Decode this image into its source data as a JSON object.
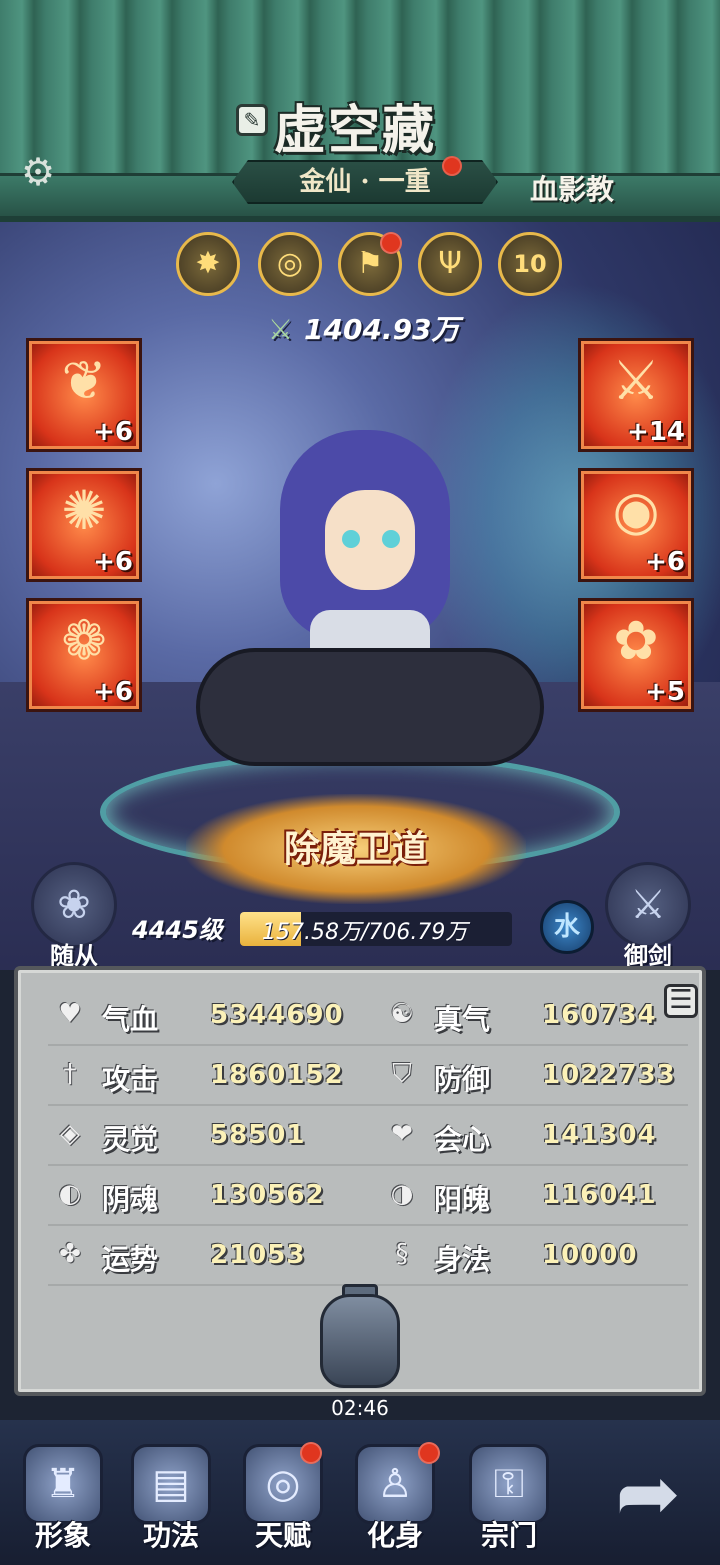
{
  "header": {
    "player_name": "虚空藏",
    "rank": "金仙 · 一重",
    "sect": "血影教",
    "settings_icon": "gear-icon",
    "edit_icon": "edit-icon"
  },
  "scene": {
    "skill_icons": [
      {
        "name": "sun-emblem-icon",
        "glyph": "✸"
      },
      {
        "name": "swirl-emblem-icon",
        "glyph": "◎"
      },
      {
        "name": "flag-emblem-icon",
        "glyph": "⚑"
      },
      {
        "name": "trident-emblem-icon",
        "glyph": "Ψ"
      },
      {
        "name": "level-badge-icon",
        "glyph": "10"
      }
    ],
    "combat_power": "1404.93万",
    "equipment_left": [
      {
        "name": "equip-armor",
        "glyph": "❦",
        "level": "+6"
      },
      {
        "name": "equip-belt",
        "glyph": "✺",
        "level": "+6"
      },
      {
        "name": "equip-necklace",
        "glyph": "❁",
        "level": "+6"
      }
    ],
    "equipment_right": [
      {
        "name": "equip-weapon",
        "glyph": "⚔",
        "level": "+14"
      },
      {
        "name": "equip-orb",
        "glyph": "◉",
        "level": "+6"
      },
      {
        "name": "equip-ring",
        "glyph": "✿",
        "level": "+5"
      }
    ],
    "title": "除魔卫道",
    "follower_label": "随从",
    "sword_label": "御剑",
    "level": "4445级",
    "exp_text": "157.58万/706.79万",
    "exp_fraction": 0.223,
    "element": "水"
  },
  "stats": {
    "rows": [
      [
        {
          "icon": "♥",
          "icon_name": "heart-icon",
          "label": "气血",
          "value": "5344690"
        },
        {
          "icon": "☯",
          "icon_name": "yin-yang-icon",
          "label": "真气",
          "value": "160734"
        }
      ],
      [
        {
          "icon": "†",
          "icon_name": "sword-icon",
          "label": "攻击",
          "value": "1860152"
        },
        {
          "icon": "⛉",
          "icon_name": "shield-icon",
          "label": "防御",
          "value": "1022733"
        }
      ],
      [
        {
          "icon": "◈",
          "icon_name": "eye-icon",
          "label": "灵觉",
          "value": "58501"
        },
        {
          "icon": "❤",
          "icon_name": "crit-heart-icon",
          "label": "会心",
          "value": "141304"
        }
      ],
      [
        {
          "icon": "◐",
          "icon_name": "yin-soul-icon",
          "label": "阴魂",
          "value": "130562"
        },
        {
          "icon": "◑",
          "icon_name": "yang-soul-icon",
          "label": "阳魄",
          "value": "116041"
        }
      ],
      [
        {
          "icon": "✤",
          "icon_name": "luck-icon",
          "label": "运势",
          "value": "21053"
        },
        {
          "icon": "§",
          "icon_name": "movement-icon",
          "label": "身法",
          "value": "10000"
        }
      ]
    ],
    "timer": "02:46"
  },
  "nav": {
    "items": [
      {
        "name": "nav-appearance",
        "icon": "robe-icon",
        "glyph": "♜",
        "label": "形象"
      },
      {
        "name": "nav-technique",
        "icon": "book-icon",
        "glyph": "▤",
        "label": "功法"
      },
      {
        "name": "nav-talent",
        "icon": "swirl-icon",
        "glyph": "◎",
        "label": "天赋"
      },
      {
        "name": "nav-avatar",
        "icon": "figure-icon",
        "glyph": "♙",
        "label": "化身"
      },
      {
        "name": "nav-sect",
        "icon": "lock-icon",
        "glyph": "⚿",
        "label": "宗门"
      }
    ],
    "back_icon": "back-arrow-icon"
  },
  "colors": {
    "header_green": "#3f7d6c",
    "equip_red": "#d8341a",
    "stat_value": "#fbf1b8",
    "notification_red": "#e0361f"
  }
}
